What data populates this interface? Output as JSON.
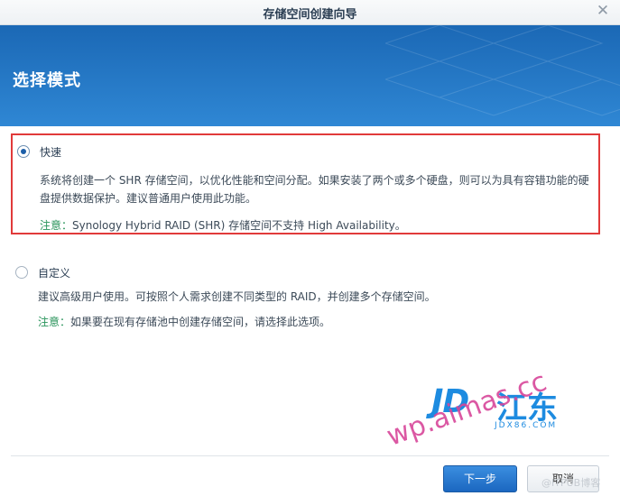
{
  "window": {
    "title": "存储空间创建向导"
  },
  "banner": {
    "title": "选择模式"
  },
  "options": [
    {
      "label": "快速",
      "selected": true,
      "description": "系统将创建一个 SHR 存储空间，以优化性能和空间分配。如果安装了两个或多个硬盘，则可以为具有容错功能的硬盘提供数据保护。建议普通用户使用此功能。",
      "note_label": "注意：",
      "note_text": "Synology Hybrid RAID (SHR) 存储空间不支持 High Availability。"
    },
    {
      "label": "自定义",
      "selected": false,
      "description": "建议高级用户使用。可按照个人需求创建不同类型的 RAID，并创建多个存储空间。",
      "note_label": "注意：",
      "note_text": "如果要在现有存储池中创建存储空间，请选择此选项。"
    }
  ],
  "buttons": {
    "next": "下一步",
    "cancel": "取消"
  },
  "watermark": {
    "brand_latin": "JD",
    "brand_cn": "江东",
    "sub": "JDX86.COM",
    "url": "wp.aimas.cc",
    "credit": "@ITPUB博客"
  },
  "colors": {
    "banner": "#1b68b5",
    "selection_box": "#e13a3a",
    "note": "#28935a",
    "primary_button": "#1b67c0"
  }
}
